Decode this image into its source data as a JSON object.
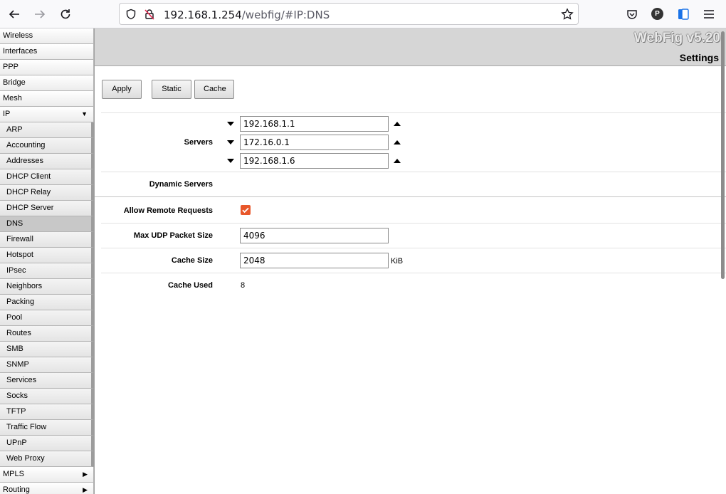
{
  "browser": {
    "url_host": "192.168.1.254",
    "url_path": "/webfig/#IP:DNS",
    "icons": [
      "back-icon",
      "forward-icon",
      "reload-icon",
      "shield-icon",
      "insecure-lock-icon",
      "bookmark-star-icon",
      "pocket-icon",
      "profile-icon",
      "extension-icon",
      "menu-icon"
    ],
    "profile_initial": "P"
  },
  "sidebar": {
    "top_items": [
      {
        "label": "Wireless"
      },
      {
        "label": "Interfaces"
      },
      {
        "label": "PPP"
      },
      {
        "label": "Bridge"
      },
      {
        "label": "Mesh"
      },
      {
        "label": "IP",
        "arrow": "▼"
      }
    ],
    "sub_items": [
      {
        "label": "ARP"
      },
      {
        "label": "Accounting"
      },
      {
        "label": "Addresses"
      },
      {
        "label": "DHCP Client"
      },
      {
        "label": "DHCP Relay"
      },
      {
        "label": "DHCP Server"
      },
      {
        "label": "DNS",
        "active": true
      },
      {
        "label": "Firewall"
      },
      {
        "label": "Hotspot"
      },
      {
        "label": "IPsec"
      },
      {
        "label": "Neighbors"
      },
      {
        "label": "Packing"
      },
      {
        "label": "Pool"
      },
      {
        "label": "Routes"
      },
      {
        "label": "SMB"
      },
      {
        "label": "SNMP"
      },
      {
        "label": "Services"
      },
      {
        "label": "Socks"
      },
      {
        "label": "TFTP"
      },
      {
        "label": "Traffic Flow"
      },
      {
        "label": "UPnP"
      },
      {
        "label": "Web Proxy"
      }
    ],
    "bottom_items": [
      {
        "label": "MPLS",
        "arrow": "▶"
      },
      {
        "label": "Routing",
        "arrow": "▶"
      }
    ]
  },
  "header": {
    "brand": "WebFig v5.20",
    "title": "Settings"
  },
  "buttons": {
    "apply": "Apply",
    "static": "Static",
    "cache": "Cache"
  },
  "form": {
    "servers_label": "Servers",
    "servers": [
      "192.168.1.1",
      "172.16.0.1",
      "192.168.1.6"
    ],
    "dynamic_servers_label": "Dynamic Servers",
    "allow_remote_label": "Allow Remote Requests",
    "allow_remote_checked": true,
    "max_udp_label": "Max UDP Packet Size",
    "max_udp_value": "4096",
    "cache_size_label": "Cache Size",
    "cache_size_value": "2048",
    "cache_size_unit": "KiB",
    "cache_used_label": "Cache Used",
    "cache_used_value": "8"
  },
  "colors": {
    "checkbox": "#e8572a",
    "header_bg": "#d6d6d6"
  }
}
